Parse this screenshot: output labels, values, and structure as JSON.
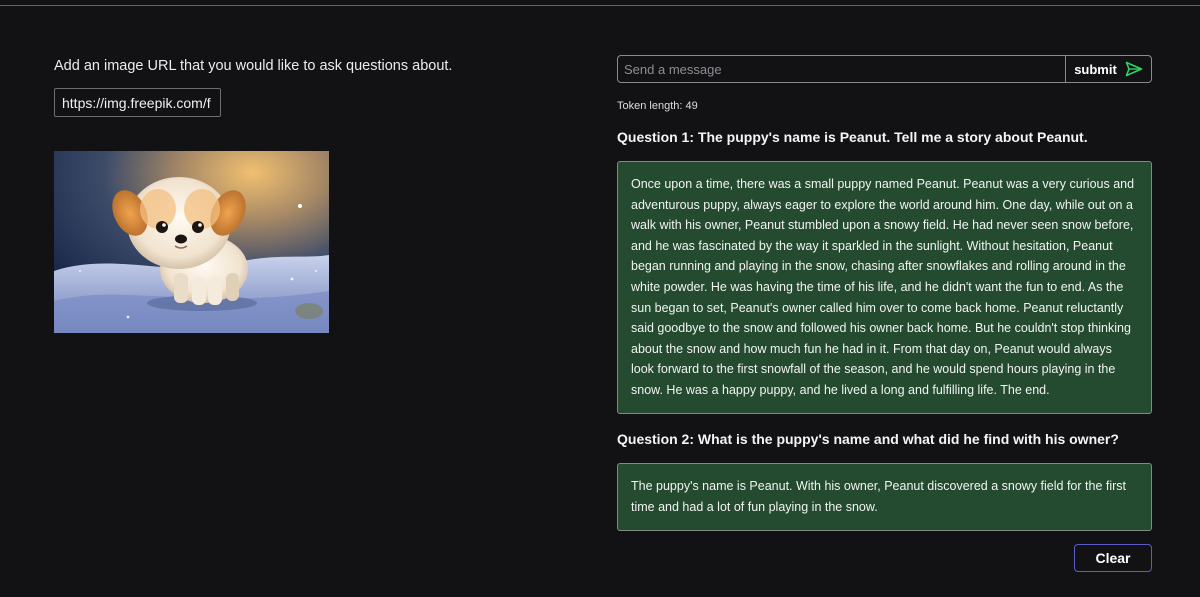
{
  "upload": {
    "prompt": "Add an image URL that you would like to ask questions about.",
    "url_value": "https://img.freepik.com/f"
  },
  "chat": {
    "message_placeholder": "Send a message",
    "submit_label": "submit",
    "token_length": "Token length: 49",
    "qa": [
      {
        "question": "Question 1: The puppy's name is Peanut. Tell me a story about Peanut.",
        "answer": "Once upon a time, there was a small puppy named Peanut. Peanut was a very curious and adventurous puppy, always eager to explore the world around him. One day, while out on a walk with his owner, Peanut stumbled upon a snowy field. He had never seen snow before, and he was fascinated by the way it sparkled in the sunlight. Without hesitation, Peanut began running and playing in the snow, chasing after snowflakes and rolling around in the white powder. He was having the time of his life, and he didn't want the fun to end. As the sun began to set, Peanut's owner called him over to come back home. Peanut reluctantly said goodbye to the snow and followed his owner back home. But he couldn't stop thinking about the snow and how much fun he had in it. From that day on, Peanut would always look forward to the first snowfall of the season, and he would spend hours playing in the snow. He was a happy puppy, and he lived a long and fulfilling life. The end."
      },
      {
        "question": "Question 2: What is the puppy's name and what did he find with his owner?",
        "answer": "The puppy's name is Peanut. With his owner, Peanut discovered a snowy field for the first time and had a lot of fun playing in the snow."
      }
    ],
    "clear_label": "Clear"
  },
  "colors": {
    "background": "#121214",
    "answer_bg": "#244a2f",
    "accent_rule": "#5a5aa8",
    "submit_icon": "#2fd168"
  },
  "icons": {
    "submit": "send-arrow-icon"
  }
}
